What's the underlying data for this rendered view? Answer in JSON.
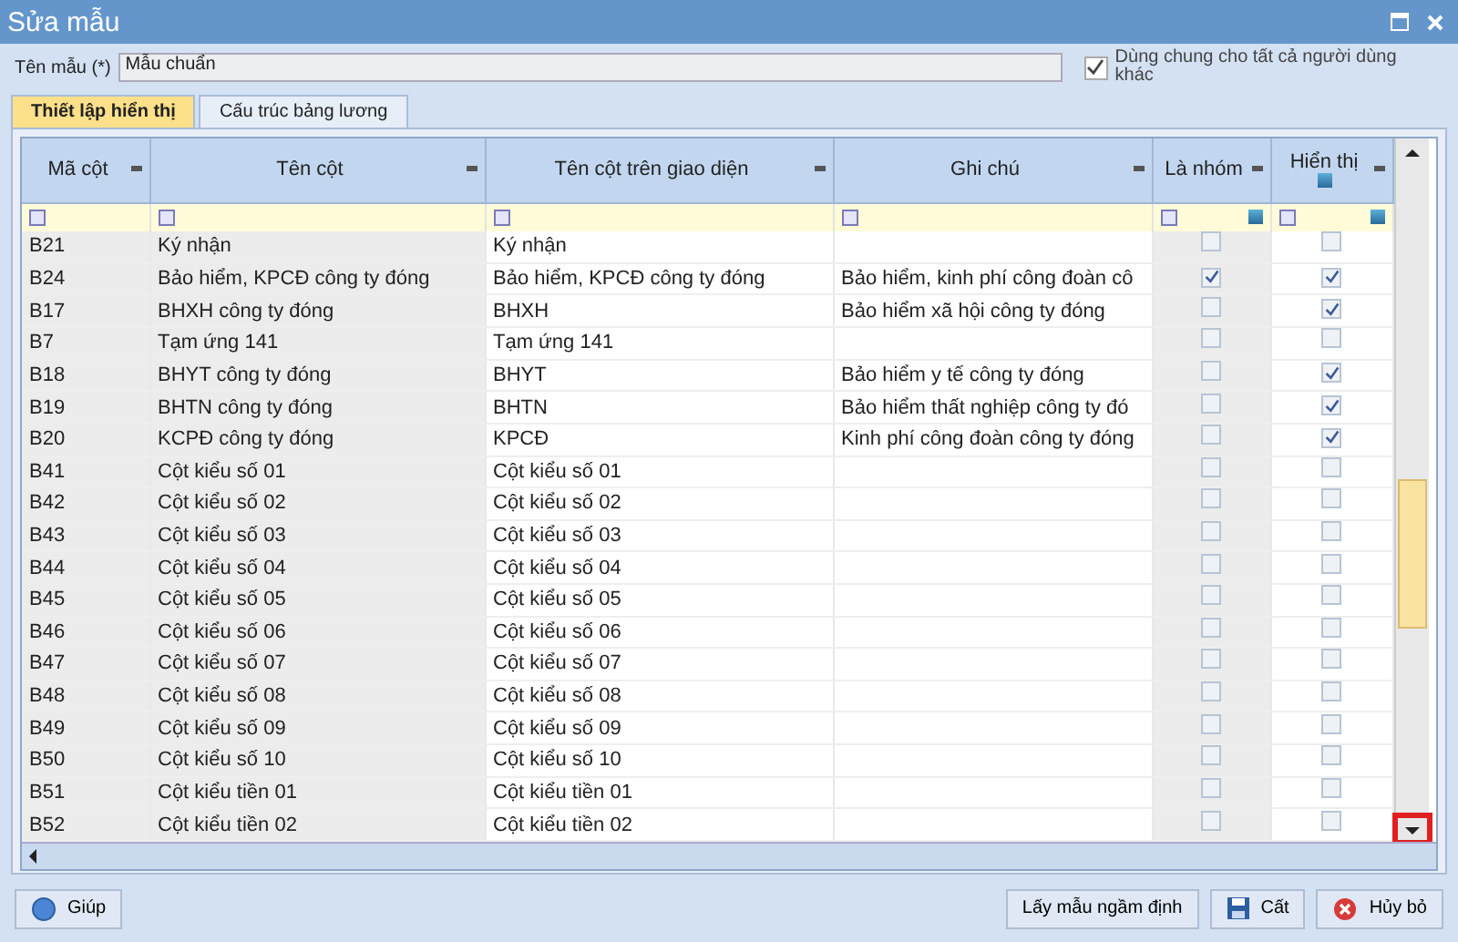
{
  "window": {
    "title": "Sửa mẫu"
  },
  "template_name": {
    "label": "Tên mẫu (*)",
    "value": "Mẫu chuẩn"
  },
  "share_checkbox": {
    "label": "Dùng chung cho tất cả người dùng khác",
    "checked": true
  },
  "tabs": [
    {
      "label": "Thiết lập hiển thị",
      "selected": true
    },
    {
      "label": "Cấu trúc bảng lương",
      "selected": false
    }
  ],
  "table": {
    "columns": [
      "Mã cột",
      "Tên cột",
      "Tên cột trên giao diện",
      "Ghi chú",
      "Là nhóm",
      "Hiển thị"
    ],
    "rows": [
      {
        "code": "B21",
        "name": "Ký nhận",
        "display_name": "Ký nhận",
        "note": "",
        "is_group": false,
        "visible": false
      },
      {
        "code": "B24",
        "name": "Bảo hiểm, KPCĐ công ty đóng",
        "display_name": "Bảo hiểm, KPCĐ công ty đóng",
        "note": "Bảo hiểm, kinh phí công đoàn cô",
        "is_group": true,
        "visible": true
      },
      {
        "code": "B17",
        "name": "BHXH công ty đóng",
        "display_name": "BHXH",
        "note": "Bảo hiểm xã hội công ty đóng",
        "is_group": false,
        "visible": true
      },
      {
        "code": "B7",
        "name": "Tạm ứng 141",
        "display_name": "Tạm ứng 141",
        "note": "",
        "is_group": false,
        "visible": false
      },
      {
        "code": "B18",
        "name": "BHYT công ty đóng",
        "display_name": "BHYT",
        "note": "Bảo hiểm y tế công ty đóng",
        "is_group": false,
        "visible": true
      },
      {
        "code": "B19",
        "name": "BHTN công ty đóng",
        "display_name": "BHTN",
        "note": "Bảo hiểm thất nghiệp công ty đó",
        "is_group": false,
        "visible": true
      },
      {
        "code": "B20",
        "name": "KCPĐ công ty đóng",
        "display_name": "KPCĐ",
        "note": "Kinh phí công đoàn công ty đóng",
        "is_group": false,
        "visible": true
      },
      {
        "code": "B41",
        "name": "Cột kiểu số 01",
        "display_name": "Cột kiểu số 01",
        "note": "",
        "is_group": false,
        "visible": false
      },
      {
        "code": "B42",
        "name": "Cột kiểu số 02",
        "display_name": "Cột kiểu số 02",
        "note": "",
        "is_group": false,
        "visible": false
      },
      {
        "code": "B43",
        "name": "Cột kiểu số 03",
        "display_name": "Cột kiểu số 03",
        "note": "",
        "is_group": false,
        "visible": false
      },
      {
        "code": "B44",
        "name": "Cột kiểu số 04",
        "display_name": "Cột kiểu số 04",
        "note": "",
        "is_group": false,
        "visible": false
      },
      {
        "code": "B45",
        "name": "Cột kiểu số 05",
        "display_name": "Cột kiểu số 05",
        "note": "",
        "is_group": false,
        "visible": false
      },
      {
        "code": "B46",
        "name": "Cột kiểu số 06",
        "display_name": "Cột kiểu số 06",
        "note": "",
        "is_group": false,
        "visible": false
      },
      {
        "code": "B47",
        "name": "Cột kiểu số 07",
        "display_name": "Cột kiểu số 07",
        "note": "",
        "is_group": false,
        "visible": false
      },
      {
        "code": "B48",
        "name": "Cột kiểu số 08",
        "display_name": "Cột kiểu số 08",
        "note": "",
        "is_group": false,
        "visible": false
      },
      {
        "code": "B49",
        "name": "Cột kiểu số 09",
        "display_name": "Cột kiểu số 09",
        "note": "",
        "is_group": false,
        "visible": false
      },
      {
        "code": "B50",
        "name": "Cột kiểu số 10",
        "display_name": "Cột kiểu số 10",
        "note": "",
        "is_group": false,
        "visible": false
      },
      {
        "code": "B51",
        "name": "Cột kiểu tiền 01",
        "display_name": "Cột kiểu tiền 01",
        "note": "",
        "is_group": false,
        "visible": false
      },
      {
        "code": "B52",
        "name": "Cột kiểu tiền 02",
        "display_name": "Cột kiểu tiền 02",
        "note": "",
        "is_group": false,
        "visible": false
      }
    ]
  },
  "scroll_down_highlighted": true,
  "buttons": {
    "help": "Giúp",
    "default_template": "Lấy mẫu ngầm định",
    "save": "Cất",
    "cancel": "Hủy bỏ"
  }
}
